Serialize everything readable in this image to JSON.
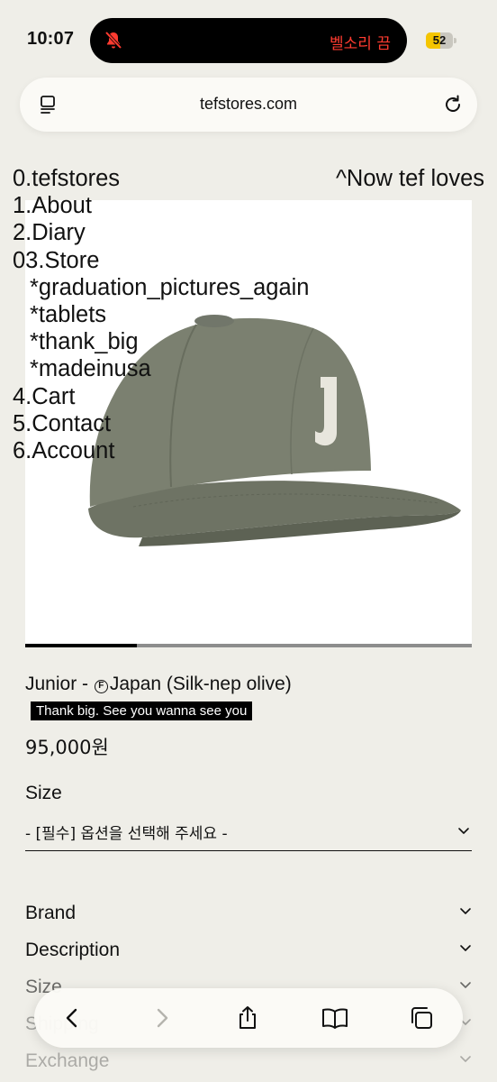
{
  "status_bar": {
    "time": "10:07",
    "silent_text": "벨소리 끔",
    "battery": 52,
    "battery_label": "52"
  },
  "browser": {
    "url": "tefstores.com"
  },
  "nav": {
    "items": [
      {
        "label": "0.tefstores",
        "sub": false
      },
      {
        "label": "1.About",
        "sub": false
      },
      {
        "label": "2.Diary",
        "sub": false
      },
      {
        "label": "03.Store",
        "sub": false
      },
      {
        "label": "*graduation_pictures_again",
        "sub": true
      },
      {
        "label": "*tablets",
        "sub": true
      },
      {
        "label": "*thank_big",
        "sub": true
      },
      {
        "label": "*madeinusa",
        "sub": true
      },
      {
        "label": "4.Cart",
        "sub": false
      },
      {
        "label": "5.Contact",
        "sub": false
      },
      {
        "label": "6.Account",
        "sub": false
      }
    ],
    "tagline": "^Now tef loves"
  },
  "product": {
    "title_prefix": "Junior - ",
    "title_badge_letter": "F",
    "title_rest": "Japan (Silk-nep olive)",
    "promo": "Thank big. See you wanna see you",
    "price": "95,000원",
    "gallery_progress": 0.25,
    "size_label": "Size",
    "size_placeholder": "- [필수] 옵션을 선택해 주세요 -"
  },
  "accordion": [
    {
      "label": "Brand"
    },
    {
      "label": "Description"
    },
    {
      "label": "Size"
    },
    {
      "label": "Shipping"
    },
    {
      "label": "Exchange"
    }
  ],
  "colors": {
    "background": "#efeee8",
    "cap": "#7b8070",
    "accent_red": "#ff3b30",
    "battery_yellow": "#f5c500"
  }
}
